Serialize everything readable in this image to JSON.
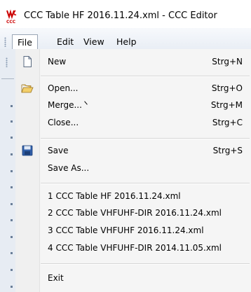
{
  "window": {
    "title": "CCC Table HF 2016.11.24.xml - CCC Editor",
    "logo_icon": "ccc-logo-icon",
    "accent": "#cc0000"
  },
  "menubar": {
    "items": [
      {
        "label": "File"
      },
      {
        "label": "Edit"
      },
      {
        "label": "View"
      },
      {
        "label": "Help"
      }
    ]
  },
  "file_menu": {
    "items": [
      {
        "label": "New",
        "shortcut": "Strg+N",
        "icon": "new-document-icon"
      },
      {
        "label": "Open...",
        "shortcut": "Strg+O",
        "icon": "open-folder-icon"
      },
      {
        "label": "Merge...",
        "shortcut": "Strg+M"
      },
      {
        "label": "Close...",
        "shortcut": "Strg+C"
      },
      {
        "label": "Save",
        "shortcut": "Strg+S",
        "icon": "save-disk-icon"
      },
      {
        "label": "Save As..."
      },
      {
        "label": "1 CCC Table HF 2016.11.24.xml"
      },
      {
        "label": "2 CCC Table VHFUHF-DIR 2016.11.24.xml"
      },
      {
        "label": "3 CCC Table VHFUHF 2016.11.24.xml"
      },
      {
        "label": "4 CCC Table VHFUHF-DIR 2014.11.05.xml"
      },
      {
        "label": "Exit"
      }
    ]
  }
}
